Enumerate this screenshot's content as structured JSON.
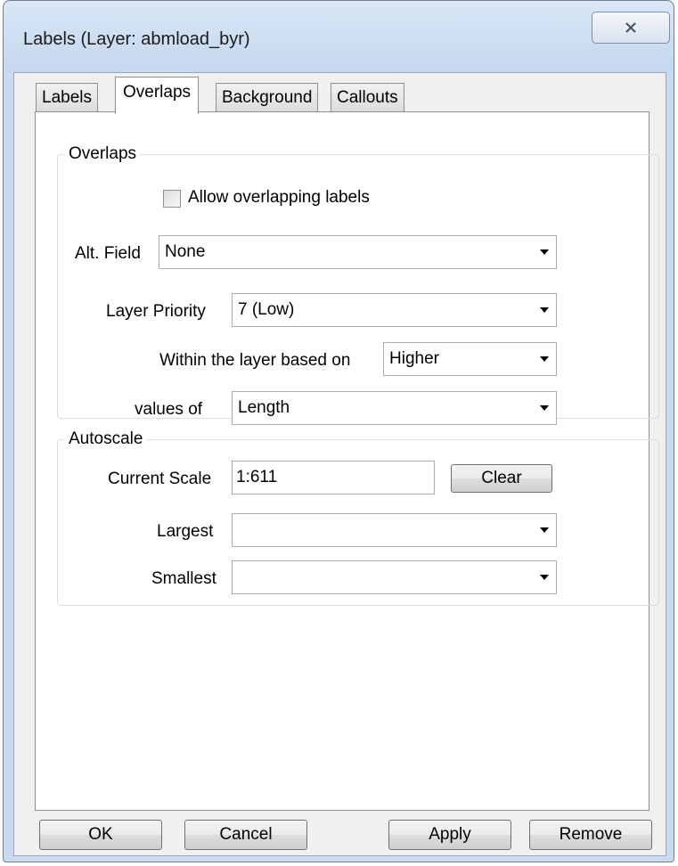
{
  "window": {
    "title": "Labels (Layer: abmload_byr)",
    "close_icon": "close-x-icon"
  },
  "tabs": [
    {
      "label": "Labels",
      "active": false
    },
    {
      "label": "Overlaps",
      "active": true
    },
    {
      "label": "Background",
      "active": false
    },
    {
      "label": "Callouts",
      "active": false
    }
  ],
  "overlaps": {
    "group_label": "Overlaps",
    "allow_overlapping_label": "Allow overlapping labels",
    "allow_overlapping_checked": false,
    "alt_field_label": "Alt. Field",
    "alt_field_value": "None",
    "layer_priority_label": "Layer Priority",
    "layer_priority_value": "7 (Low)",
    "within_layer_label": "Within the layer based on",
    "within_layer_value": "Higher",
    "values_of_label": "values of",
    "values_of_value": "Length"
  },
  "autoscale": {
    "group_label": "Autoscale",
    "current_scale_label": "Current Scale",
    "current_scale_value": "1:611",
    "clear_label": "Clear",
    "largest_label": "Largest",
    "largest_value": "",
    "smallest_label": "Smallest",
    "smallest_value": ""
  },
  "buttons": {
    "ok": "OK",
    "cancel": "Cancel",
    "apply": "Apply",
    "remove": "Remove"
  }
}
